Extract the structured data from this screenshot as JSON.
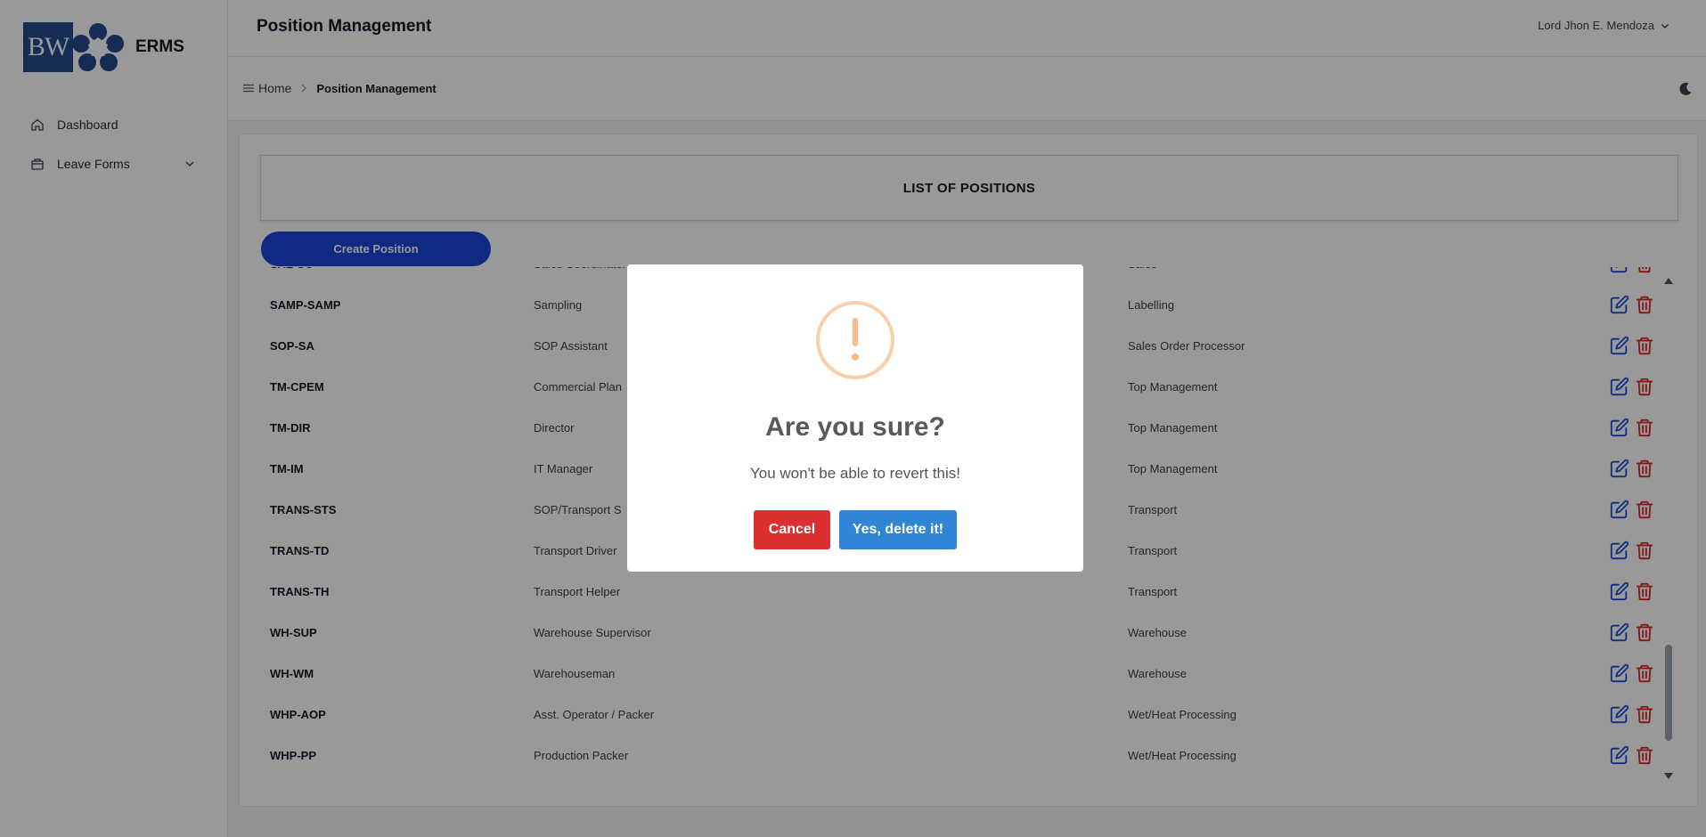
{
  "app": {
    "logo_text": "BW",
    "name": "ERMS"
  },
  "sidebar": {
    "items": [
      {
        "label": "Dashboard",
        "icon": "home-icon"
      },
      {
        "label": "Leave Forms",
        "icon": "folder-icon",
        "has_dropdown": true
      }
    ]
  },
  "header": {
    "title": "Position Management",
    "user_name": "Lord Jhon E. Mendoza"
  },
  "breadcrumb": {
    "home": "Home",
    "current": "Position Management"
  },
  "main": {
    "list_title": "LIST OF POSITIONS",
    "create_button": "Create Position"
  },
  "table": {
    "rows": [
      {
        "code": "SAL-SC",
        "position": "Sales Coordinator",
        "department": "Sales"
      },
      {
        "code": "SAMP-SAMP",
        "position": "Sampling",
        "department": "Labelling"
      },
      {
        "code": "SOP-SA",
        "position": "SOP Assistant",
        "department": "Sales Order Processor"
      },
      {
        "code": "TM-CPEM",
        "position": "Commercial Plan",
        "department": "Top Management"
      },
      {
        "code": "TM-DIR",
        "position": "Director",
        "department": "Top Management"
      },
      {
        "code": "TM-IM",
        "position": "IT Manager",
        "department": "Top Management"
      },
      {
        "code": "TRANS-STS",
        "position": "SOP/Transport S",
        "department": "Transport"
      },
      {
        "code": "TRANS-TD",
        "position": "Transport Driver",
        "department": "Transport"
      },
      {
        "code": "TRANS-TH",
        "position": "Transport Helper",
        "department": "Transport"
      },
      {
        "code": "WH-SUP",
        "position": "Warehouse Supervisor",
        "department": "Warehouse"
      },
      {
        "code": "WH-WM",
        "position": "Warehouseman",
        "department": "Warehouse"
      },
      {
        "code": "WHP-AOP",
        "position": "Asst. Operator / Packer",
        "department": "Wet/Heat Processing"
      },
      {
        "code": "WHP-PP",
        "position": "Production Packer",
        "department": "Wet/Heat Processing"
      }
    ]
  },
  "modal": {
    "icon": "warning-exclamation-icon",
    "title": "Are you sure?",
    "text": "You won't be able to revert this!",
    "cancel_label": "Cancel",
    "confirm_label": "Yes, delete it!"
  },
  "colors": {
    "primary": "#1d46d8",
    "cancel": "#dc2f2f",
    "confirm": "#3085d6",
    "warning": "#f8bb86",
    "edit_icon": "#1d4ed8",
    "delete_icon": "#dc2626"
  }
}
